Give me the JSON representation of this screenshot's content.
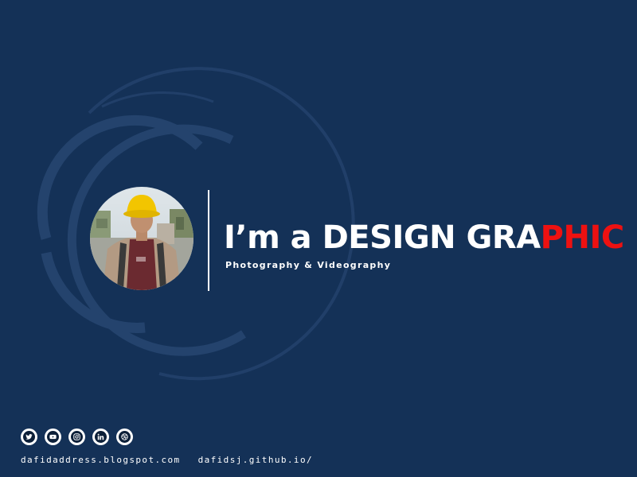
{
  "hero": {
    "headline_main": "I’m a DESIGN GRA",
    "headline_accent": "PHIC",
    "subtitle": "Photography & Videography",
    "accent_color": "#ee1111",
    "background_color": "#143157"
  },
  "avatar": {
    "icon": "profile-photo"
  },
  "socials": [
    {
      "name": "twitter",
      "icon": "twitter-icon"
    },
    {
      "name": "youtube",
      "icon": "youtube-icon"
    },
    {
      "name": "instagram",
      "icon": "instagram-icon"
    },
    {
      "name": "linkedin",
      "icon": "linkedin-icon"
    },
    {
      "name": "dribbble",
      "icon": "dribbble-icon"
    }
  ],
  "links": [
    "dafidaddress.blogspot.com",
    "dafidsj.github.io/"
  ]
}
